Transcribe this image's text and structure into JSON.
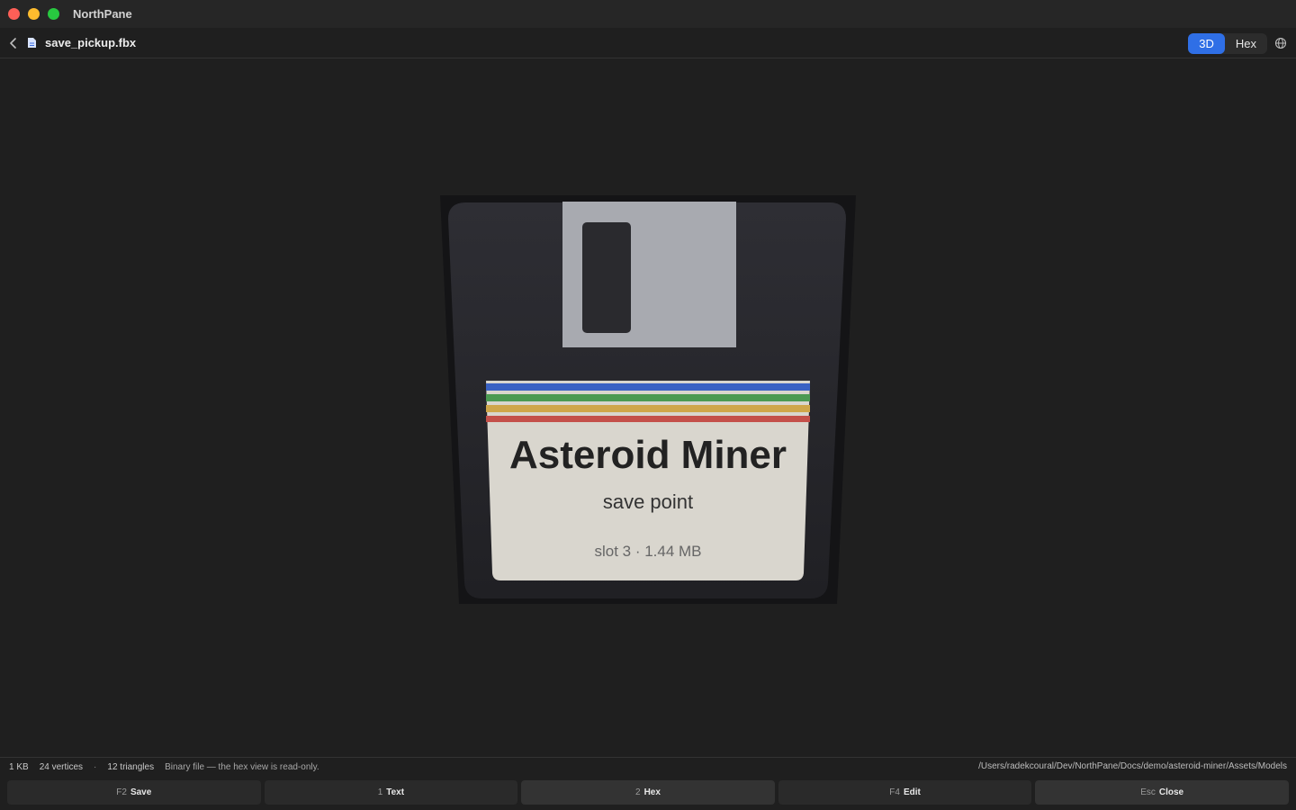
{
  "window": {
    "title": "NorthPane",
    "traffic_lights": {
      "close": "#fe5f57",
      "minimize": "#febc2e",
      "zoom": "#28c840"
    }
  },
  "toolbar": {
    "back_icon": "chevron-left-icon",
    "file_icon": "document-icon",
    "filename": "save_pickup.fbx",
    "view_modes": [
      {
        "label": "3D",
        "active": true
      },
      {
        "label": "Hex",
        "active": false
      }
    ],
    "accent_color": "#2f6fe6",
    "globe_icon": "globe-icon"
  },
  "model": {
    "label_title": "Asteroid Miner",
    "label_subtitle": "save point",
    "label_footer": "slot 3 · 1.44 MB",
    "stripe_colors": [
      "#3a62c4",
      "#4b9a52",
      "#cfa64a",
      "#c4504a"
    ],
    "body_color": "#26262b",
    "shutter_color": "#a8aab0",
    "label_color": "#d9d6ce"
  },
  "status": {
    "size": "1 KB",
    "vertices": "24 vertices",
    "separator": "·",
    "triangles": "12 triangles",
    "note": "Binary file — the hex view is read-only.",
    "path": "/Users/radekcoural/Dev/NorthPane/Docs/demo/asteroid-miner/Assets/Models"
  },
  "fkeys": [
    {
      "key": "F2",
      "label": "Save"
    },
    {
      "key": "1",
      "label": "Text"
    },
    {
      "key": "2",
      "label": "Hex"
    },
    {
      "key": "F4",
      "label": "Edit"
    },
    {
      "key": "Esc",
      "label": "Close"
    }
  ]
}
